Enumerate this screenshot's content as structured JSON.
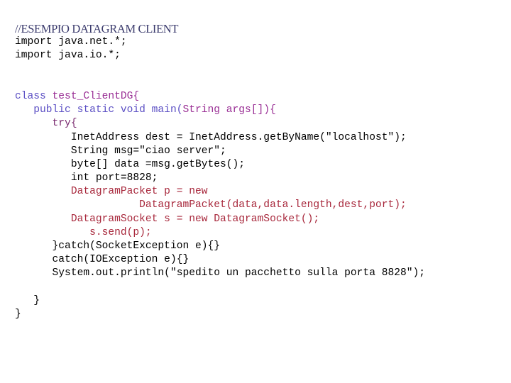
{
  "document": {
    "kind": "code-listing",
    "language": "java",
    "background_color": "#ffffff"
  },
  "palette": {
    "black": "#000000",
    "navy_serif": "#3b3b6d",
    "violet": "#5b4fc4",
    "magenta": "#9a2f95",
    "dark_magenta": "#7a2b70",
    "red": "#a8283c"
  },
  "lines": [
    {
      "id": "line-comment-title",
      "style": "comment-serif",
      "spans": [
        {
          "text": "//ESEMPIO DATAGRAM CLIENT",
          "color": "navy_serif"
        }
      ]
    },
    {
      "id": "line-import-net",
      "style": "code",
      "spans": [
        {
          "text": "import java.net.*;",
          "color": "black"
        }
      ]
    },
    {
      "id": "line-import-io",
      "style": "code",
      "spans": [
        {
          "text": "import java.io.*;",
          "color": "black"
        }
      ]
    },
    {
      "id": "line-blank-1",
      "style": "blank",
      "spans": [
        {
          "text": " ",
          "color": "black"
        }
      ]
    },
    {
      "id": "line-blank-2",
      "style": "blank",
      "spans": [
        {
          "text": " ",
          "color": "black"
        }
      ]
    },
    {
      "id": "line-class-decl",
      "style": "code",
      "spans": [
        {
          "text": "class ",
          "color": "violet"
        },
        {
          "text": "test_ClientDG{",
          "color": "magenta"
        }
      ]
    },
    {
      "id": "line-main-method",
      "style": "code",
      "spans": [
        {
          "text": "   public static void main(",
          "color": "violet"
        },
        {
          "text": "String args[]){",
          "color": "magenta"
        }
      ]
    },
    {
      "id": "line-try",
      "style": "code",
      "spans": [
        {
          "text": "      try{",
          "color": "dark_magenta"
        }
      ]
    },
    {
      "id": "line-inetaddress",
      "style": "code",
      "spans": [
        {
          "text": "         InetAddress dest = InetAddress.getByName(\"localhost\");",
          "color": "black"
        }
      ]
    },
    {
      "id": "line-msg",
      "style": "code",
      "spans": [
        {
          "text": "         String msg=\"ciao server\";",
          "color": "black"
        }
      ]
    },
    {
      "id": "line-bytes",
      "style": "code",
      "spans": [
        {
          "text": "         byte[] data =msg.getBytes();",
          "color": "black"
        }
      ]
    },
    {
      "id": "line-port",
      "style": "code",
      "spans": [
        {
          "text": "         int port=8828;",
          "color": "black"
        }
      ]
    },
    {
      "id": "line-packet-decl",
      "style": "code",
      "spans": [
        {
          "text": "         DatagramPacket p = new",
          "color": "red"
        }
      ]
    },
    {
      "id": "line-packet-ctor",
      "style": "code",
      "spans": [
        {
          "text": "                    DatagramPacket(data,data.length,dest,port);",
          "color": "red"
        }
      ]
    },
    {
      "id": "line-socket-decl",
      "style": "code",
      "spans": [
        {
          "text": "         DatagramSocket s = new DatagramSocket();",
          "color": "red"
        }
      ]
    },
    {
      "id": "line-send",
      "style": "code",
      "spans": [
        {
          "text": "            s.send(p);",
          "color": "red"
        }
      ]
    },
    {
      "id": "line-catch-socket",
      "style": "code",
      "spans": [
        {
          "text": "      }catch(SocketException e){}",
          "color": "black"
        }
      ]
    },
    {
      "id": "line-catch-io",
      "style": "code",
      "spans": [
        {
          "text": "      catch(IOException e){}",
          "color": "black"
        }
      ]
    },
    {
      "id": "line-println",
      "style": "code",
      "spans": [
        {
          "text": "      System.out.println(\"spedito un pacchetto sulla porta 8828\");",
          "color": "black"
        }
      ]
    },
    {
      "id": "line-blank-3",
      "style": "blank",
      "spans": [
        {
          "text": " ",
          "color": "black"
        }
      ]
    },
    {
      "id": "line-close-method",
      "style": "code",
      "spans": [
        {
          "text": "   }",
          "color": "black"
        }
      ]
    },
    {
      "id": "line-close-class",
      "style": "code",
      "spans": [
        {
          "text": "}",
          "color": "black"
        }
      ]
    }
  ]
}
